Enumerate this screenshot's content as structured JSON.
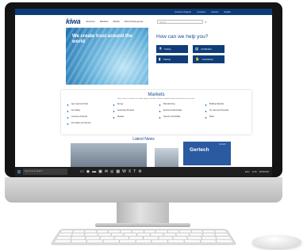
{
  "website": {
    "topbar": [
      "Contact & Support",
      "Locations",
      "Careers",
      "English"
    ],
    "logo": "kiwa",
    "nav": [
      "Services",
      "Markets",
      "Media",
      "About Kiwa group"
    ],
    "search_placeholder": "Search",
    "hero": {
      "tagline": "We create trust around the world"
    },
    "help": {
      "title": "How can we help you?",
      "buttons": [
        {
          "label": "Testing",
          "icon": "beaker"
        },
        {
          "label": "Certification",
          "icon": "certificate"
        },
        {
          "label": "Training",
          "icon": "book"
        },
        {
          "label": "Consultancy",
          "icon": "hand"
        }
      ]
    },
    "markets": {
      "title": "Markets",
      "intro": "Kiwa serves customers in a wide range of markets. Select a market to learn more about our services.",
      "items": [
        "Agri, Feed and Food",
        "Energy",
        "Manufacturing",
        "Building Materials",
        "Fire Safety",
        "Automotive Products",
        "Environmental & Water",
        "Oil, Gas and Chemicals",
        "Consumer Products",
        "Medical",
        "Telecom and Mobility",
        "Water",
        "Fire Safety and Security"
      ]
    },
    "news": {
      "title": "Latest News",
      "card_title": "Gertech",
      "card_sub": "Gertech"
    }
  },
  "taskbar": {
    "start_icon": "windows-icon",
    "search_placeholder": "Type here to search",
    "apps": [
      "task-view",
      "edge",
      "explorer",
      "store",
      "mail",
      "chrome",
      "photos",
      "word",
      "excel",
      "teams",
      "settings"
    ],
    "tray": [
      "ENG",
      "11:48",
      "26/05/2020"
    ]
  }
}
